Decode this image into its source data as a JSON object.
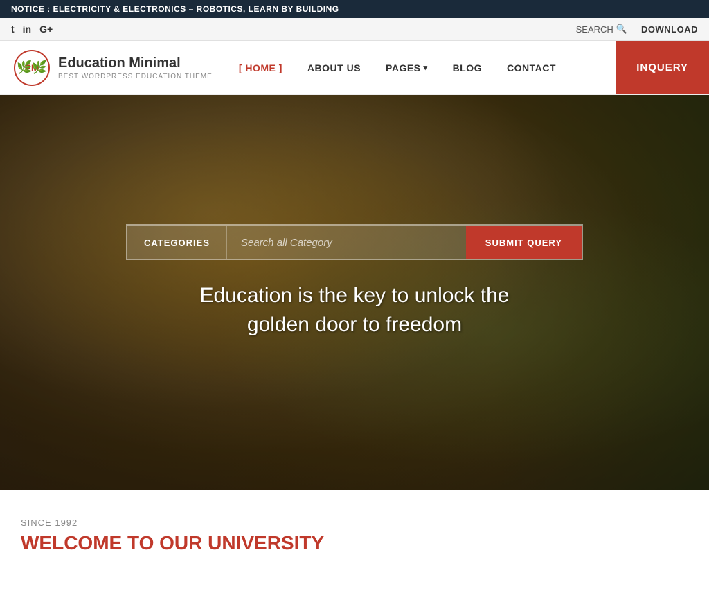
{
  "notice": {
    "prefix": "NOTICE :",
    "text": "ELECTRICITY & ELECTRONICS – ROBOTICS, LEARN BY BUILDING"
  },
  "topbar": {
    "social": [
      {
        "label": "t",
        "name": "twitter"
      },
      {
        "label": "in",
        "name": "linkedin"
      },
      {
        "label": "G+",
        "name": "googleplus"
      }
    ],
    "search_label": "SEARCH",
    "download_label": "DOWNLOAD"
  },
  "nav": {
    "logo_initials": "EM",
    "logo_title": "Education Minimal",
    "logo_subtitle": "BEST WORDPRESS EDUCATION THEME",
    "items": [
      {
        "label": "[ HOME ]",
        "active": true,
        "id": "home"
      },
      {
        "label": "ABOUT US",
        "active": false,
        "id": "about"
      },
      {
        "label": "PAGES",
        "active": false,
        "id": "pages",
        "has_dropdown": true
      },
      {
        "label": "BLOG",
        "active": false,
        "id": "blog"
      },
      {
        "label": "CONTACT",
        "active": false,
        "id": "contact"
      }
    ],
    "inquiry_label": "INQUERY"
  },
  "hero": {
    "categories_label": "CATEGORIES",
    "search_placeholder": "Search all Category",
    "submit_label": "SUBMIT QUERY",
    "tagline": "Education is the key to unlock the golden door to freedom"
  },
  "below_hero": {
    "since_label": "SINCE 1992",
    "welcome_title": "WELCOME TO OUR UNIVERSITY"
  }
}
